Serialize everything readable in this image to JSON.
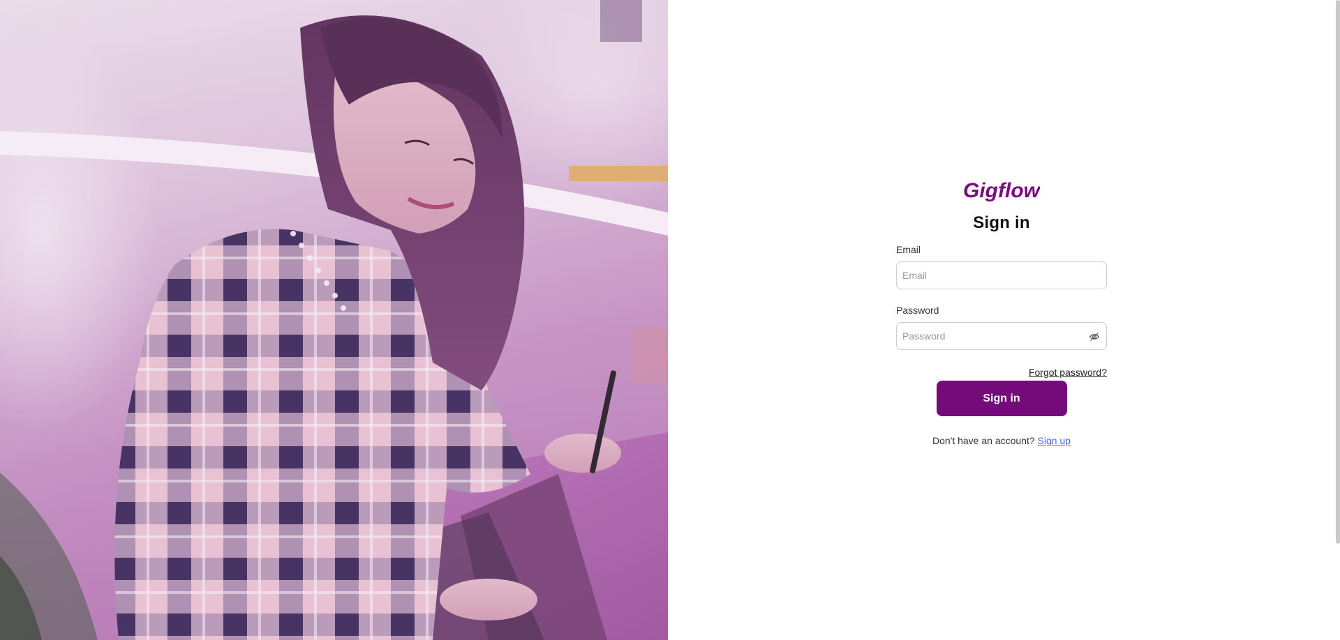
{
  "brand": {
    "logo_text": "Gigflow",
    "logo_color": "#7a0a7f"
  },
  "form": {
    "title": "Sign in",
    "email": {
      "label": "Email",
      "placeholder": "Email",
      "value": ""
    },
    "password": {
      "label": "Password",
      "placeholder": "Password",
      "value": "",
      "toggle_icon": "eye-slash-icon"
    },
    "forgot_password": "Forgot password?",
    "submit_label": "Sign in",
    "submit_color": "#750a7a",
    "signup_prompt": "Don't have an account?",
    "signup_link": "Sign up",
    "signup_link_color": "#3f6fd1"
  },
  "hero": {
    "image": "woman-with-laptop-photo"
  }
}
